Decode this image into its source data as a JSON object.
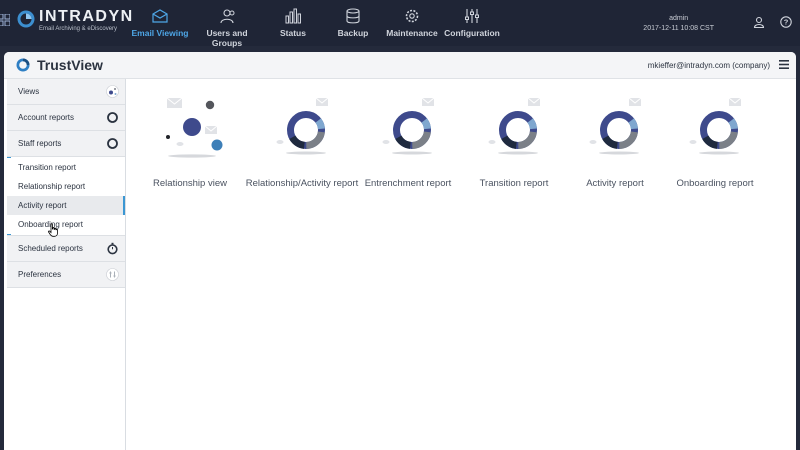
{
  "app": {
    "brand": "INTRADYN",
    "brand_sub": "Email Archiving & eDiscovery"
  },
  "nav": {
    "items": [
      {
        "label": "Email Viewing",
        "icon": "envelope-icon",
        "active": true
      },
      {
        "label": "Users and Groups",
        "icon": "users-icon",
        "active": false
      },
      {
        "label": "Status",
        "icon": "bar-chart-icon",
        "active": false
      },
      {
        "label": "Backup",
        "icon": "database-icon",
        "active": false
      },
      {
        "label": "Maintenance",
        "icon": "gear-icon",
        "active": false
      },
      {
        "label": "Configuration",
        "icon": "sliders-icon",
        "active": false
      }
    ]
  },
  "user": {
    "name": "admin",
    "datetime": "2017-12-11 10:08 CST"
  },
  "panel": {
    "title": "TrustView",
    "account": "mkieffer@intradyn.com (company)"
  },
  "sidebar": {
    "sections": [
      {
        "label": "Views",
        "icon": "views-icon"
      },
      {
        "label": "Account reports",
        "icon": "ring-icon"
      },
      {
        "label": "Staff reports",
        "icon": "ring-icon"
      }
    ],
    "staff_items": [
      {
        "label": "Transition report",
        "selected": false
      },
      {
        "label": "Relationship report",
        "selected": false
      },
      {
        "label": "Activity report",
        "selected": true
      },
      {
        "label": "Onboarding report",
        "selected": false
      }
    ],
    "bottom_sections": [
      {
        "label": "Scheduled reports",
        "icon": "stopwatch-icon"
      },
      {
        "label": "Preferences",
        "icon": "preferences-icon"
      }
    ]
  },
  "tiles": [
    {
      "label": "Relationship view",
      "kind": "bubbles"
    },
    {
      "label": "Relationship/Activity report",
      "kind": "donut"
    },
    {
      "label": "Entrenchment report",
      "kind": "donut"
    },
    {
      "label": "Transition report",
      "kind": "donut"
    },
    {
      "label": "Activity report",
      "kind": "donut"
    },
    {
      "label": "Onboarding report",
      "kind": "donut"
    }
  ],
  "colors": {
    "accent": "#3b97d3",
    "topbar": "#1f2536",
    "donut_dark": "#3e4a8c",
    "donut_gray": "#7b8088",
    "donut_navy": "#1f2a3f",
    "donut_light": "#7fa7cf"
  }
}
